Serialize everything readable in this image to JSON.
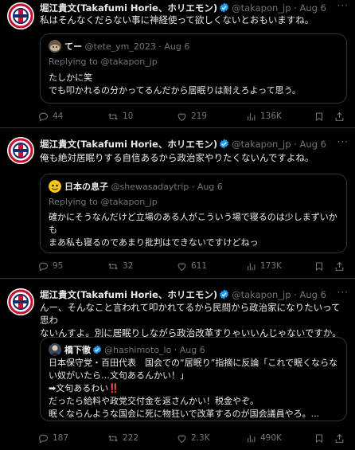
{
  "posts": [
    {
      "author": {
        "name": "堀江貴文(Takafumi Horie、ホリエモン)",
        "handle": "@takapon_jp",
        "time": "Aug 6"
      },
      "text": [
        "私はそんなくだらない事に神経使って欲しくないとおもいますね。"
      ],
      "quote": {
        "name": "てー",
        "handle": "@tete_ym_2023",
        "time": "Aug 6",
        "replying": "Replying to @takapon_jp",
        "text": [
          "たしかに笑",
          "でも叩かれるの分かってるんだから居眠りは耐えろよって思う。"
        ]
      },
      "stats": {
        "replies": "44",
        "reposts": "10",
        "likes": "219",
        "views": "136K"
      }
    },
    {
      "author": {
        "name": "堀江貴文(Takafumi Horie、ホリエモン)",
        "handle": "@takapon_jp",
        "time": "Aug 6"
      },
      "text": [
        "俺も絶対居眠りする自信あるから政治家やりたくないんですよね。"
      ],
      "quote": {
        "name": "日本の息子",
        "handle": "@shewasadaytrip",
        "time": "Aug 6",
        "replying": "Replying to @takapon_jp",
        "text": [
          "確かにそうなんだけど立場のある人がこういう場で寝るのは少しまずいか",
          "も",
          "まあ私も寝るのであまり批判はできないですけどねっ"
        ]
      },
      "stats": {
        "replies": "95",
        "reposts": "32",
        "likes": "611",
        "views": "173K"
      }
    },
    {
      "author": {
        "name": "堀江貴文(Takafumi Horie、ホリエモン)",
        "handle": "@takapon_jp",
        "time": "Aug 6"
      },
      "text": [
        "んー、そんなこと言われて叩かれてるから民間から政治家になりたいって思わ",
        "ないんすよ。別に居眠りしながら政治改革すりゃいいんじゃないですか。"
      ],
      "quote": {
        "name": "橋下徹",
        "handle": "@hashimoto_lo",
        "time": "Aug 6",
        "replying": "",
        "text": [
          "日本保守党・百田代表　国会での“居眠り”指摘に反論「これで眠くならな",
          "い奴がいたら…文句あるんかい！」",
          "➡文句あるわい‼️",
          "だったら給料や政党交付金を返さんかい！税金やぞ。",
          "眠くならんような国会に死に物狂いで改革するのが国会議員やろ。..."
        ]
      },
      "stats": {
        "replies": "187",
        "reposts": "222",
        "likes": "2.3K",
        "views": "490K"
      }
    }
  ],
  "colors": {
    "background": "#000000",
    "text": "#e7e9ea",
    "muted": "#71767b",
    "border": "#2f3336",
    "verified": "#1d9bf0"
  },
  "icons": [
    "reply-icon",
    "repost-icon",
    "like-icon",
    "views-icon",
    "bookmark-icon",
    "share-icon",
    "verified-badge-icon",
    "more-icon"
  ]
}
